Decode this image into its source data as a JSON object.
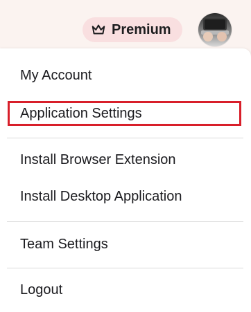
{
  "header": {
    "premium_label": "Premium",
    "icons": {
      "crown": "crown-icon",
      "avatar": "user-avatar"
    }
  },
  "menu": {
    "items": [
      {
        "label": "My Account"
      },
      {
        "label": "Application Settings"
      },
      {
        "label": "Install Browser Extension"
      },
      {
        "label": "Install Desktop Application"
      },
      {
        "label": "Team Settings"
      },
      {
        "label": "Logout"
      }
    ]
  },
  "colors": {
    "header_background": "#fbf3f0",
    "premium_badge_background": "#f9dfe0",
    "highlight_border": "#d81f2a",
    "divider": "#d9d9d9",
    "text": "#1b1b1f"
  }
}
